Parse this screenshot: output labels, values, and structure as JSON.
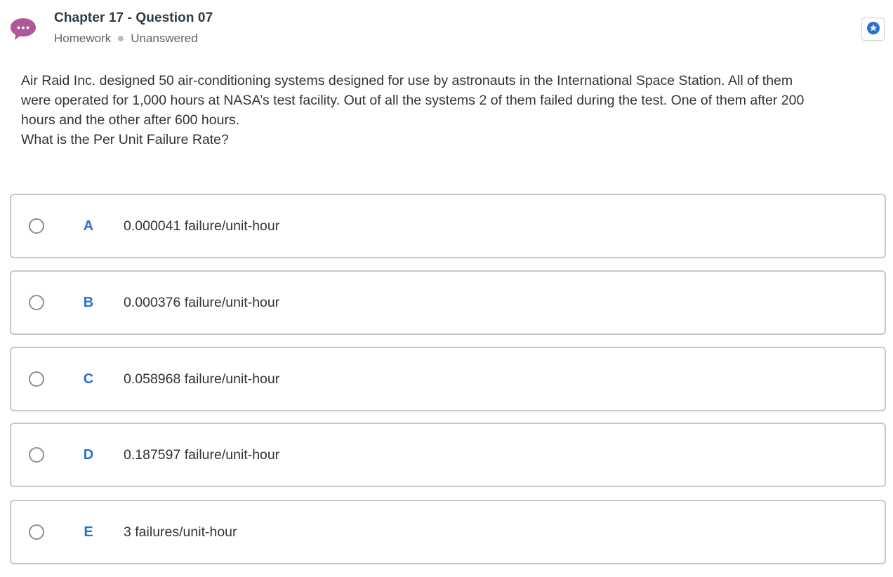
{
  "header": {
    "title": "Chapter 17 - Question 07",
    "type": "Homework",
    "status": "Unanswered",
    "chat_icon": "chat-bubble-icon",
    "star_icon": "star-icon",
    "accent_color": "#b0579a",
    "star_color": "#2a6fd6"
  },
  "question": {
    "line1": "Air Raid Inc. designed 50 air-conditioning systems designed for use by astronauts in the International Space Station. All of them",
    "line2": "were operated for 1,000 hours at NASA’s test facility. Out of all the systems 2 of them failed during the test. One of them after 200",
    "line3": "hours and the other after 600 hours.",
    "prompt": "What is the Per Unit Failure Rate?"
  },
  "options": [
    {
      "letter": "A",
      "text": "0.000041 failure/unit-hour"
    },
    {
      "letter": "B",
      "text": "0.000376 failure/unit-hour"
    },
    {
      "letter": "C",
      "text": "0.058968 failure/unit-hour"
    },
    {
      "letter": "D",
      "text": "0.187597 failure/unit-hour"
    },
    {
      "letter": "E",
      "text": "3 failures/unit-hour"
    }
  ],
  "letter_color": "#2a6fd6"
}
